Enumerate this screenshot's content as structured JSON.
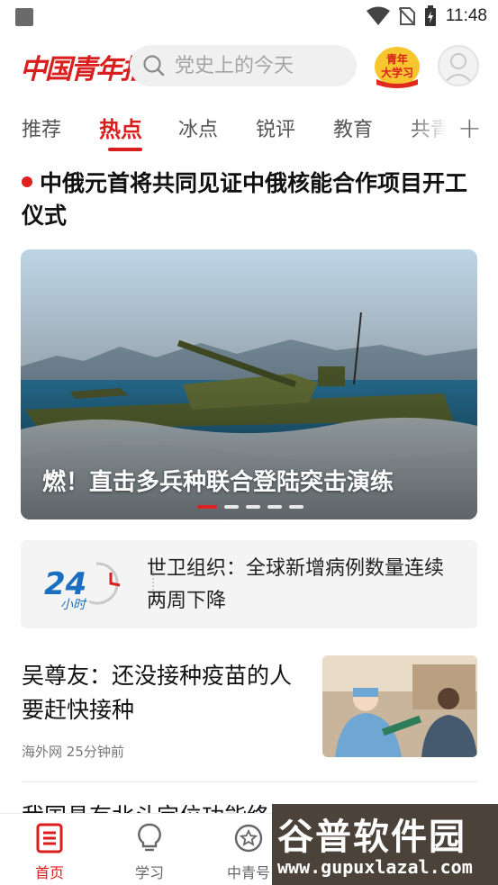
{
  "status_bar": {
    "time": "11:48"
  },
  "header": {
    "logo_text": "中国青年报",
    "search_placeholder": "党史上的今天",
    "study_badge": [
      "青年",
      "大学习"
    ]
  },
  "tabs": [
    {
      "label": "推荐",
      "active": false
    },
    {
      "label": "热点",
      "active": true
    },
    {
      "label": "冰点",
      "active": false
    },
    {
      "label": "锐评",
      "active": false
    },
    {
      "label": "教育",
      "active": false
    },
    {
      "label": "共青",
      "active": false
    }
  ],
  "tab_add": "+",
  "headline": "中俄元首将共同见证中俄核能合作项目开工仪式",
  "banner": {
    "caption": "燃！直击多兵种联合登陆突击演练",
    "slides": 5,
    "active_slide": 1
  },
  "card24": {
    "logo_number": "24",
    "logo_sub": "小时",
    "text": "世卫组织：全球新增病例数量连续两周下降"
  },
  "article": {
    "title": "吴尊友：还没接种疫苗的人要赶快接种",
    "source": "海外网",
    "time": "25分钟前"
  },
  "article2": {
    "title": "我国具有北斗定位功能终"
  },
  "bottom_nav": [
    {
      "label": "首页",
      "icon": "home-icon",
      "active": true
    },
    {
      "label": "学习",
      "icon": "lightbulb-icon",
      "active": false
    },
    {
      "label": "中青号",
      "icon": "star-badge-icon",
      "active": false
    }
  ],
  "watermark": {
    "main": "谷普软件园",
    "sub": "www.gupuxlazal.com"
  },
  "colors": {
    "brand_red": "#d91e1e"
  }
}
